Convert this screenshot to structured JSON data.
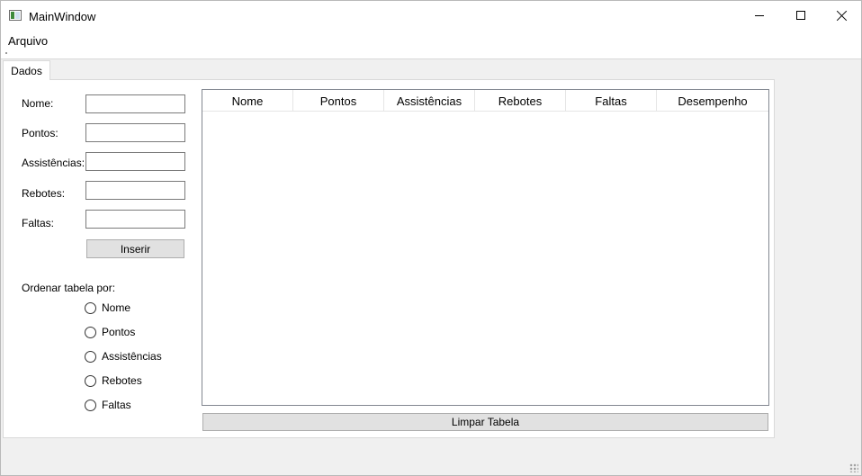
{
  "window": {
    "title": "MainWindow",
    "icon": "app-window-icon",
    "controls": [
      "minimize-icon",
      "maximize-icon",
      "close-icon"
    ]
  },
  "menubar": {
    "items": [
      {
        "label": "Arquivo"
      }
    ]
  },
  "tabs": [
    {
      "label": "Dados",
      "selected": true
    }
  ],
  "form": {
    "fields": [
      {
        "label": "Nome:",
        "value": ""
      },
      {
        "label": "Pontos:",
        "value": ""
      },
      {
        "label": "Assistências:",
        "value": ""
      },
      {
        "label": "Rebotes:",
        "value": ""
      },
      {
        "label": "Faltas:",
        "value": ""
      }
    ],
    "insert_label": "Inserir"
  },
  "sort": {
    "label": "Ordenar tabela por:",
    "options": [
      {
        "label": "Nome",
        "checked": false
      },
      {
        "label": "Pontos",
        "checked": false
      },
      {
        "label": "Assistências",
        "checked": false
      },
      {
        "label": "Rebotes",
        "checked": false
      },
      {
        "label": "Faltas",
        "checked": false
      }
    ]
  },
  "table": {
    "columns": [
      "Nome",
      "Pontos",
      "Assistências",
      "Rebotes",
      "Faltas",
      "Desempenho"
    ],
    "rows": []
  },
  "clear_label": "Limpar Tabela"
}
